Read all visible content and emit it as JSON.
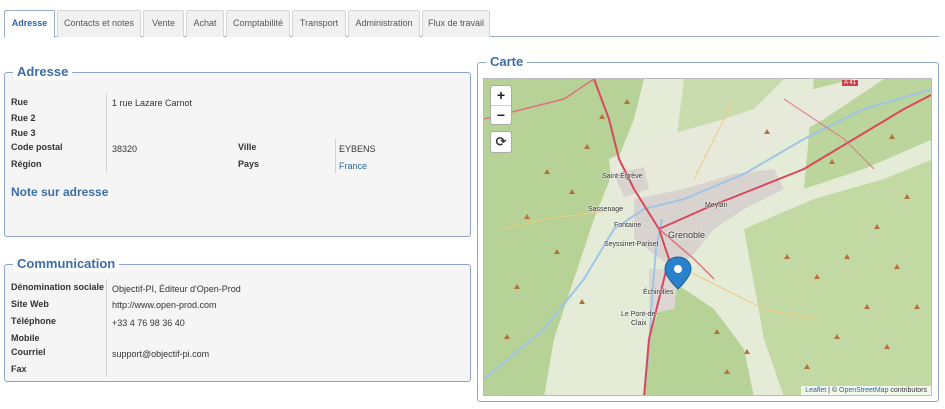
{
  "tabs": [
    {
      "label": "Adresse",
      "active": true
    },
    {
      "label": "Contacts et notes",
      "active": false
    },
    {
      "label": "Vente",
      "active": false
    },
    {
      "label": "Achat",
      "active": false
    },
    {
      "label": "Comptabilité",
      "active": false
    },
    {
      "label": "Transport",
      "active": false
    },
    {
      "label": "Administration",
      "active": false
    },
    {
      "label": "Flux de travail",
      "active": false
    }
  ],
  "adresse": {
    "title": "Adresse",
    "rue_label": "Rue",
    "rue_value": "1 rue Lazare Carnot",
    "rue2_label": "Rue 2",
    "rue3_label": "Rue 3",
    "cp_label": "Code postal",
    "cp_value": "38320",
    "ville_label": "Ville",
    "ville_value": "EYBENS",
    "region_label": "Région",
    "pays_label": "Pays",
    "pays_value": "France",
    "note_title": "Note sur adresse"
  },
  "communication": {
    "title": "Communication",
    "denom_label": "Dénomination sociale",
    "denom_value": "Objectif-PI, Éditeur d'Open-Prod",
    "site_label": "Site Web",
    "site_value": "http://www.open-prod.com",
    "tel_label": "Téléphone",
    "tel_value": "+33 4 76 98 36 40",
    "mobile_label": "Mobile",
    "courriel_label": "Courriel",
    "courriel_value": "support@objectif-pi.com",
    "fax_label": "Fax"
  },
  "carte": {
    "title": "Carte",
    "zoom_in": "+",
    "zoom_out": "−",
    "refresh": "⟳",
    "attrib_leaflet": "Leaflet",
    "attrib_sep": " | © ",
    "attrib_osm": "OpenStreetMap",
    "attrib_tail": " contributors",
    "places": {
      "grenoble": "Grenoble",
      "saint_egreve": "Saint-Égrève",
      "sassenage": "Sassenage",
      "fontaine": "Fontaine",
      "seyssinet": "Seyssinet-Pariset",
      "meylan": "Meylan",
      "echirolles": "Échirolles",
      "pont_de_claix_1": "Le Pont-de-",
      "pont_de_claix_2": "Claix",
      "road": "A 41"
    },
    "colors": {
      "forest": "#b9d49a",
      "urban": "#d9d4cf",
      "road": "#e0727e",
      "motorway": "#d7485b",
      "marker": "#2a81cb"
    }
  }
}
